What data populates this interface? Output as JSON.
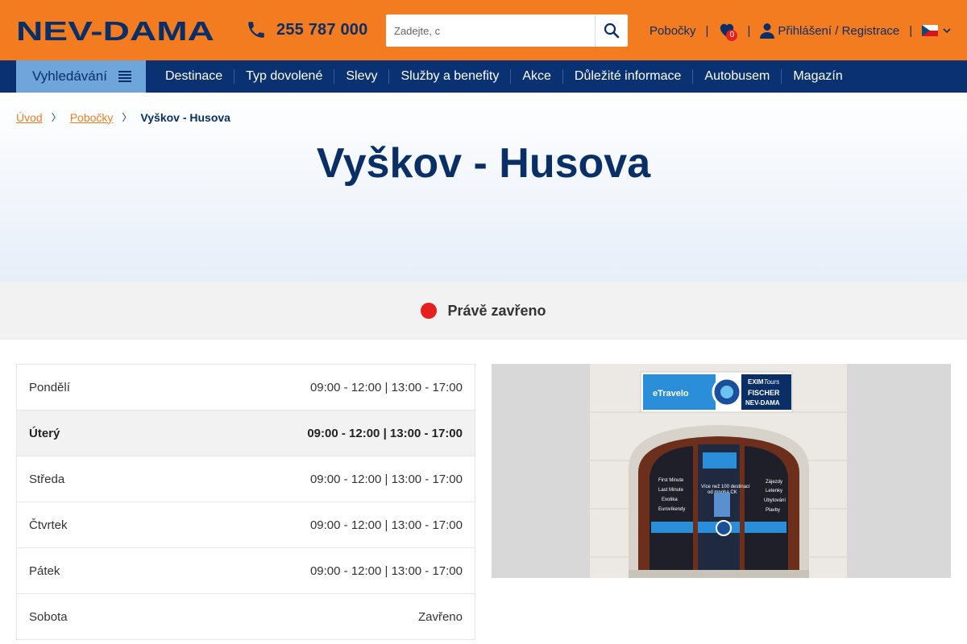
{
  "header": {
    "logo_text": "NEV-DAMA",
    "phone": "255 787 000",
    "search_placeholder": "Zadejte, c",
    "branches_link": "Pobočky",
    "favorites_count": "0",
    "login_link": "Přihlášení / Registrace",
    "language": "cs"
  },
  "nav": {
    "search_label": "Vyhledávání",
    "items": [
      "Destinace",
      "Typ dovolené",
      "Slevy",
      "Služby a benefity",
      "Akce",
      "Důležité informace",
      "Autobusem",
      "Magazín"
    ]
  },
  "breadcrumb": {
    "home": "Úvod",
    "branches": "Pobočky",
    "current": "Vyškov - Husova"
  },
  "page_title": "Vyškov - Husova",
  "status": {
    "text": "Právě zavřeno",
    "color": "#e5201f"
  },
  "opening_hours": [
    {
      "day": "Pondělí",
      "hours": "09:00 - 12:00 | 13:00 - 17:00",
      "today": false
    },
    {
      "day": "Úterý",
      "hours": "09:00 - 12:00 | 13:00 - 17:00",
      "today": true
    },
    {
      "day": "Středa",
      "hours": "09:00 - 12:00 | 13:00 - 17:00",
      "today": false
    },
    {
      "day": "Čtvrtek",
      "hours": "09:00 - 12:00 | 13:00 - 17:00",
      "today": false
    },
    {
      "day": "Pátek",
      "hours": "09:00 - 12:00 | 13:00 - 17:00",
      "today": false
    },
    {
      "day": "Sobota",
      "hours": "Zavřeno",
      "today": false
    }
  ],
  "storefront_sign": {
    "brand_left": "eTravelo",
    "brand_right_1": "EXIM",
    "brand_right_1b": "Tours",
    "brand_right_2": "FISCHER",
    "brand_right_3": "NEV-DAMA",
    "window_left": [
      "First Minute",
      "Last Minute",
      "Exotika",
      "Eurovíkendy"
    ],
    "window_middle": [
      "Více než 100 destinací",
      "od mnoha CK"
    ],
    "window_right": [
      "Zájezdy",
      "Letenky",
      "Ubytování",
      "Plavby"
    ]
  },
  "colors": {
    "brand_orange": "#f47c20",
    "brand_navy": "#0a3272",
    "nav_search_bg": "#6ea6dc"
  }
}
